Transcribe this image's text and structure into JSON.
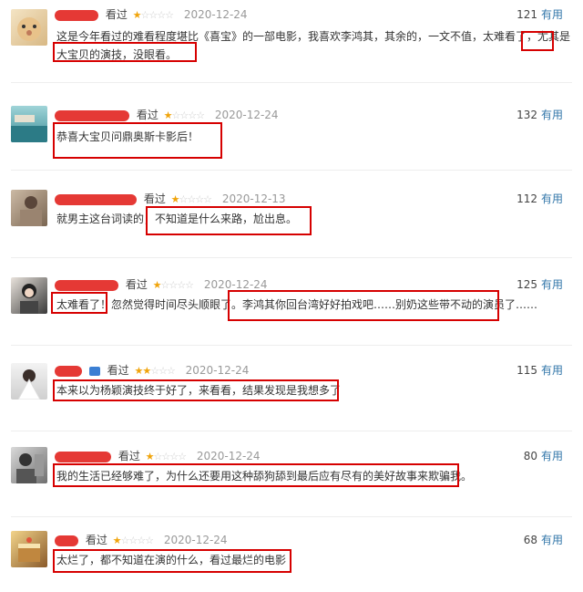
{
  "reviews": [
    {
      "watched": "看过",
      "rating": 1,
      "date": "2020-12-24",
      "votes": "121",
      "useful": "有用",
      "line1": "这是今年看过的难看程度堪比《喜宝》的一部电影，我喜欢李鸿其，其余的，一文不值，太难看了，尤其是",
      "line2": "大宝贝的演技，没眼看。"
    },
    {
      "watched": "看过",
      "rating": 1,
      "date": "2020-12-24",
      "votes": "132",
      "useful": "有用",
      "line1": "恭喜大宝贝问鼎奥斯卡影后！"
    },
    {
      "watched": "看过",
      "rating": 1,
      "date": "2020-12-13",
      "votes": "112",
      "useful": "有用",
      "line1": "就男主这台词读的，不知道是什么来路，尬出息。"
    },
    {
      "watched": "看过",
      "rating": 1,
      "date": "2020-12-24",
      "votes": "125",
      "useful": "有用",
      "line1": "太难看了！忽然觉得时间尽头顺眼了。李鸿其你回台湾好好拍戏吧……别奶这些带不动的演员了……"
    },
    {
      "watched": "看过",
      "rating": 2,
      "date": "2020-12-24",
      "votes": "115",
      "useful": "有用",
      "line1": "本来以为杨颖演技终于好了，来看看，结果发现是我想多了"
    },
    {
      "watched": "看过",
      "rating": 1,
      "date": "2020-12-24",
      "votes": "80",
      "useful": "有用",
      "line1": "我的生活已经够难了，为什么还要用这种舔狗舔到最后应有尽有的美好故事来欺骗我。"
    },
    {
      "watched": "看过",
      "rating": 1,
      "date": "2020-12-24",
      "votes": "68",
      "useful": "有用",
      "line1": "太烂了，都不知道在演的什么，看过最烂的电影"
    }
  ]
}
